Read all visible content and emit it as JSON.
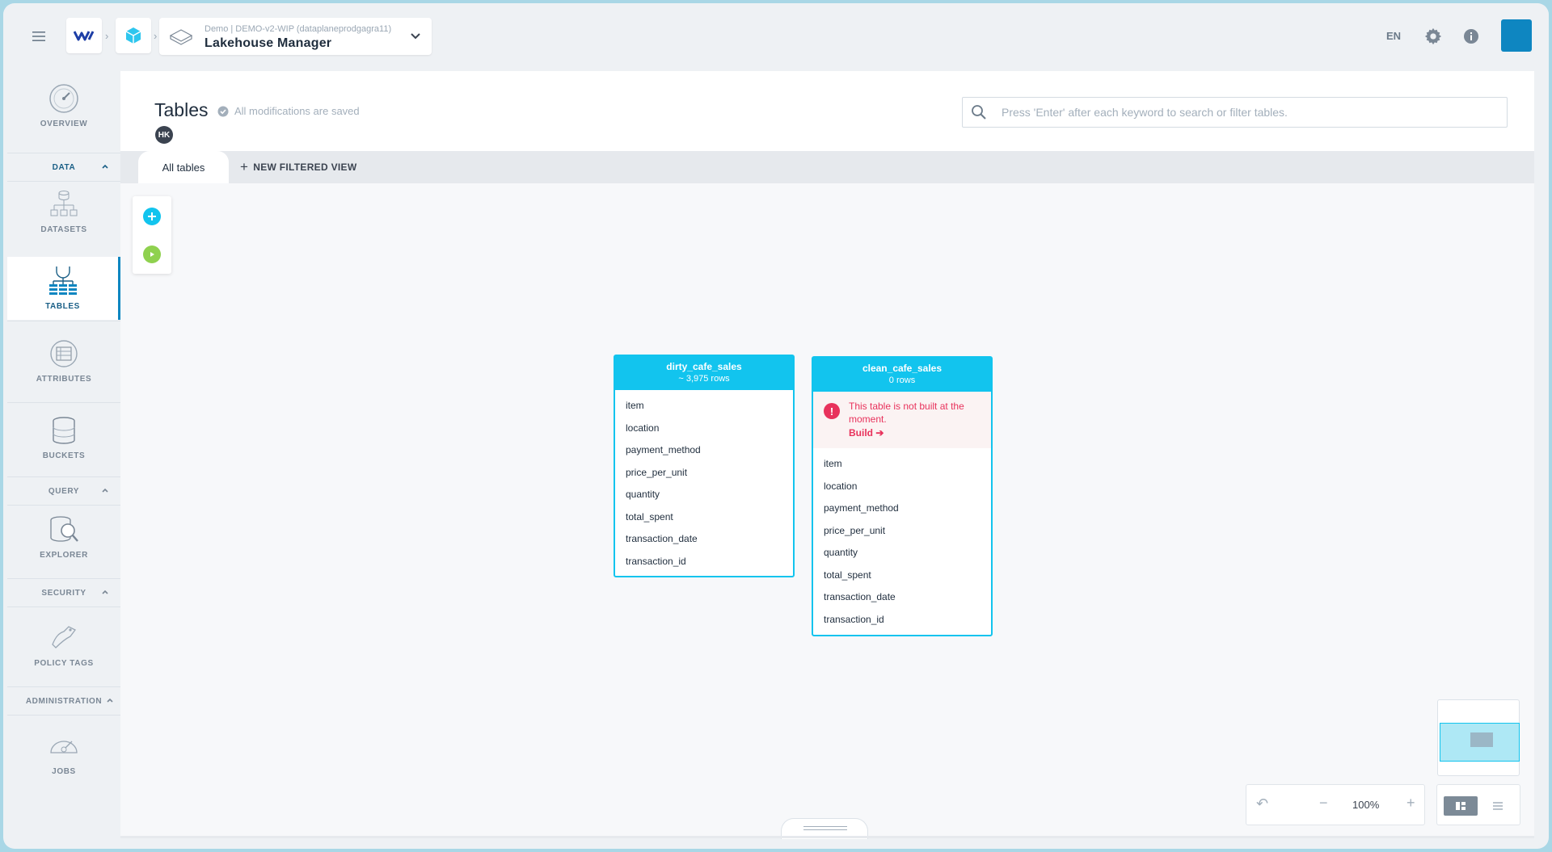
{
  "topbar": {
    "crumb_sub": "Demo | DEMO-v2-WIP (dataplaneprodgagra11)",
    "crumb_title": "Lakehouse Manager",
    "lang": "EN"
  },
  "sidebar": {
    "overview": "OVERVIEW",
    "sections": {
      "data": "DATA",
      "query": "QUERY",
      "security": "SECURITY",
      "administration": "ADMINISTRATION"
    },
    "items": {
      "datasets": "DATASETS",
      "tables": "TABLES",
      "attributes": "ATTRIBUTES",
      "buckets": "BUCKETS",
      "explorer": "EXPLORER",
      "policy_tags": "POLICY TAGS",
      "jobs": "JOBS"
    }
  },
  "header": {
    "title": "Tables",
    "saved_status": "All modifications are saved",
    "user_initials": "HK",
    "search_placeholder": "Press 'Enter' after each keyword to search or filter tables."
  },
  "tabs": {
    "all_tables": "All tables",
    "new_view": "NEW FILTERED VIEW"
  },
  "tables": [
    {
      "name": "dirty_cafe_sales",
      "rows": "~ 3,975 rows",
      "columns": [
        "item",
        "location",
        "payment_method",
        "price_per_unit",
        "quantity",
        "total_spent",
        "transaction_date",
        "transaction_id"
      ]
    },
    {
      "name": "clean_cafe_sales",
      "rows": "0 rows",
      "warning": "This table is not built at the moment.",
      "build_label": "Build",
      "columns": [
        "item",
        "location",
        "payment_method",
        "price_per_unit",
        "quantity",
        "total_spent",
        "transaction_date",
        "transaction_id"
      ]
    }
  ],
  "zoom": {
    "value": "100%"
  }
}
